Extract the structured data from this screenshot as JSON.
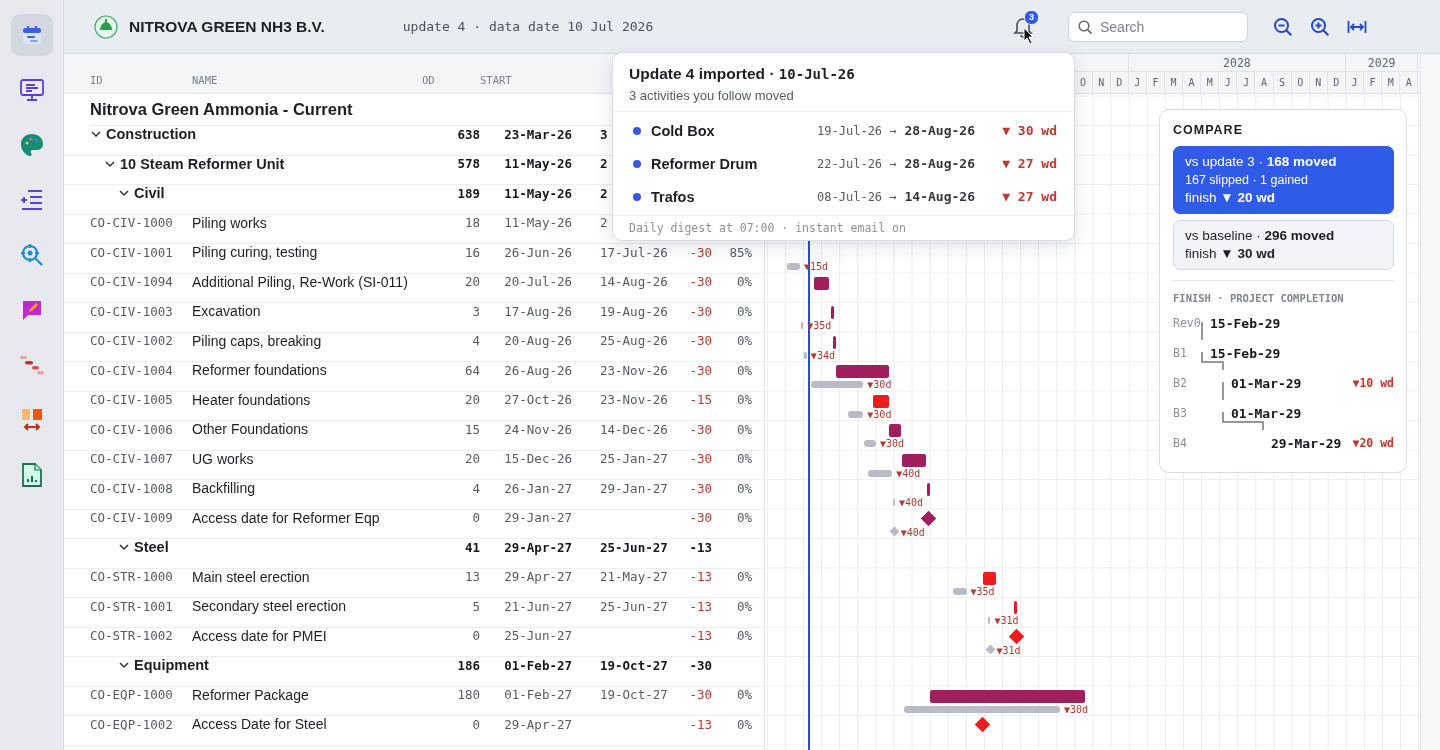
{
  "sidebar": {
    "items": [
      {
        "selected": true
      },
      {
        "selected": false
      },
      {
        "selected": false
      },
      {
        "selected": false
      },
      {
        "selected": false
      },
      {
        "selected": false
      },
      {
        "selected": false
      },
      {
        "selected": false
      },
      {
        "selected": false
      }
    ]
  },
  "header": {
    "company": "NITROVA GREEN NH3 B.V.",
    "update_info": "update 4 · data date 10 Jul 2026",
    "notification_badge": "3",
    "search": {
      "placeholder": "Search"
    }
  },
  "table": {
    "columns": [
      "ID",
      "NAME",
      "OD",
      "START"
    ],
    "project": "Nitrova Green Ammonia - Current",
    "rows": [
      {
        "kind": "group",
        "name": "Construction",
        "od": "638",
        "start": "23-Mar-26",
        "finish": "3",
        "expanded": true,
        "children": [
          {
            "kind": "group",
            "name": "10 Steam Reformer Unit",
            "od": "578",
            "start": "11-May-26",
            "finish": "2",
            "expanded": true,
            "children": [
              {
                "kind": "group",
                "name": "Civil",
                "od": "189",
                "start": "11-May-26",
                "finish": "2",
                "expanded": true,
                "children": [
                  {
                    "kind": "task",
                    "id": "CO-CIV-1000",
                    "name": "Piling works",
                    "od": "18",
                    "start": "11-May-26",
                    "finish": "2"
                  },
                  {
                    "kind": "task",
                    "id": "CO-CIV-1001",
                    "name": "Piling curing, testing",
                    "od": "16",
                    "start": "26-Jun-26",
                    "finish": "17-Jul-26",
                    "tf": "-30",
                    "pct": "85%",
                    "slip": "▼15d"
                  },
                  {
                    "kind": "task",
                    "id": "CO-CIV-1094",
                    "name": "Additional Piling, Re-Work (SI-011)",
                    "od": "20",
                    "start": "20-Jul-26",
                    "finish": "14-Aug-26",
                    "tf": "-30",
                    "pct": "0%",
                    "color": "#a21f5e"
                  },
                  {
                    "kind": "task",
                    "id": "CO-CIV-1003",
                    "name": "Excavation",
                    "od": "3",
                    "start": "17-Aug-26",
                    "finish": "19-Aug-26",
                    "tf": "-30",
                    "pct": "0%",
                    "color": "#a21f5e",
                    "slip": "▼35d"
                  },
                  {
                    "kind": "task",
                    "id": "CO-CIV-1002",
                    "name": "Piling caps, breaking",
                    "od": "4",
                    "start": "20-Aug-26",
                    "finish": "25-Aug-26",
                    "tf": "-30",
                    "pct": "0%",
                    "color": "#a21f5e",
                    "slip": "▼34d"
                  },
                  {
                    "kind": "task",
                    "id": "CO-CIV-1004",
                    "name": "Reformer foundations",
                    "od": "64",
                    "start": "26-Aug-26",
                    "finish": "23-Nov-26",
                    "tf": "-30",
                    "pct": "0%",
                    "color": "#a21f5e",
                    "slip": "▼30d"
                  },
                  {
                    "kind": "task",
                    "id": "CO-CIV-1005",
                    "name": "Heater foundations",
                    "od": "20",
                    "start": "27-Oct-26",
                    "finish": "23-Nov-26",
                    "tf": "-15",
                    "pct": "0%",
                    "color": "#ee1c1c",
                    "slip": "▼30d"
                  },
                  {
                    "kind": "task",
                    "id": "CO-CIV-1006",
                    "name": "Other Foundations",
                    "od": "15",
                    "start": "24-Nov-26",
                    "finish": "14-Dec-26",
                    "tf": "-30",
                    "pct": "0%",
                    "color": "#a21f5e",
                    "slip": "▼30d"
                  },
                  {
                    "kind": "task",
                    "id": "CO-CIV-1007",
                    "name": "UG works",
                    "od": "20",
                    "start": "15-Dec-26",
                    "finish": "25-Jan-27",
                    "tf": "-30",
                    "pct": "0%",
                    "color": "#a21f5e",
                    "slip": "▼40d"
                  },
                  {
                    "kind": "task",
                    "id": "CO-CIV-1008",
                    "name": "Backfilling",
                    "od": "4",
                    "start": "26-Jan-27",
                    "finish": "29-Jan-27",
                    "tf": "-30",
                    "pct": "0%",
                    "color": "#a21f5e",
                    "slip": "▼40d"
                  },
                  {
                    "kind": "milestone",
                    "id": "CO-CIV-1009",
                    "name": "Access date for Reformer Eqp",
                    "od": "0",
                    "start": "29-Jan-27",
                    "tf": "-30",
                    "pct": "0%",
                    "color": "#a21f5e",
                    "slip": "▼40d"
                  }
                ]
              },
              {
                "kind": "group",
                "name": "Steel",
                "od": "41",
                "start": "29-Apr-27",
                "finish": "25-Jun-27",
                "tf": "-13",
                "expanded": true,
                "children": [
                  {
                    "kind": "task",
                    "id": "CO-STR-1000",
                    "name": "Main steel erection",
                    "od": "13",
                    "start": "29-Apr-27",
                    "finish": "21-May-27",
                    "tf": "-13",
                    "pct": "0%",
                    "color": "#ee1c1c",
                    "slip": "▼35d"
                  },
                  {
                    "kind": "task",
                    "id": "CO-STR-1001",
                    "name": "Secondary steel erection",
                    "od": "5",
                    "start": "21-Jun-27",
                    "finish": "25-Jun-27",
                    "tf": "-13",
                    "pct": "0%",
                    "color": "#ee1c1c",
                    "slip": "▼31d"
                  },
                  {
                    "kind": "milestone",
                    "id": "CO-STR-1002",
                    "name": "Access date for PMEI",
                    "od": "0",
                    "start": "25-Jun-27",
                    "tf": "-13",
                    "pct": "0%",
                    "color": "#ee1c1c",
                    "slip": "▼31d"
                  }
                ]
              },
              {
                "kind": "group",
                "name": "Equipment",
                "od": "186",
                "start": "01-Feb-27",
                "finish": "19-Oct-27",
                "tf": "-30",
                "expanded": true,
                "children": [
                  {
                    "kind": "task",
                    "id": "CO-EQP-1000",
                    "name": "Reformer Package",
                    "od": "180",
                    "start": "01-Feb-27",
                    "finish": "19-Oct-27",
                    "tf": "-30",
                    "pct": "0%",
                    "color": "#a21f5e",
                    "slip": "▼30d"
                  },
                  {
                    "kind": "milestone",
                    "id": "CO-EQP-1002",
                    "name": "Access Date for Steel",
                    "od": "0",
                    "start": "29-Apr-27",
                    "tf": "-13",
                    "pct": "0%",
                    "color": "#ee1c1c"
                  }
                ]
              }
            ]
          }
        ]
      }
    ]
  },
  "timeline": {
    "earlier_months": [
      "O",
      "N",
      "D"
    ],
    "years": [
      {
        "label": "2028",
        "months": [
          "J",
          "F",
          "M",
          "A",
          "M",
          "J",
          "J",
          "A",
          "S",
          "O",
          "N",
          "D"
        ]
      },
      {
        "label": "2029",
        "months": [
          "J",
          "F",
          "M",
          "A"
        ]
      }
    ]
  },
  "notification_popup": {
    "title": "Update 4 imported · **10-Jul-26**",
    "subtitle": "3 activities you follow moved",
    "items": [
      {
        "name": "Cold Box",
        "from": "19-Jul-26 →",
        "to": "28-Aug-26",
        "delta": "▼ 30 wd"
      },
      {
        "name": "Reformer Drum",
        "from": "22-Jul-26 →",
        "to": "28-Aug-26",
        "delta": "▼ 27 wd"
      },
      {
        "name": "Trafos",
        "from": "08-Jul-26 →",
        "to": "14-Aug-26",
        "delta": "▼ 27 wd"
      }
    ],
    "footer": "Daily digest at 07:00 · instant email on"
  },
  "compare": {
    "title": "COMPARE",
    "options": [
      {
        "selected": true,
        "lines": [
          "vs update 3 · **168 moved**",
          "167 slipped · 1 gained",
          "finish **▼ 20 wd**"
        ]
      },
      {
        "selected": false,
        "lines": [
          "vs baseline · **296 moved**",
          "finish **▼ 30 wd**"
        ]
      }
    ],
    "finish_heading": "FINISH · PROJECT COMPLETION",
    "revisions": [
      {
        "entries": [
          {
            "label": "Rev0",
            "date": "15-Feb-29"
          },
          {
            "label": "B1",
            "date": "15-Feb-29"
          }
        ]
      },
      {
        "entries": [
          {
            "label": "B2",
            "date": "01-Mar-29",
            "delta": "▼10 wd"
          },
          {
            "label": "B3",
            "date": "01-Mar-29"
          }
        ]
      },
      {
        "entries": [
          {
            "label": "B4",
            "date": "29-Mar-29",
            "delta": "▼20 wd"
          }
        ]
      }
    ]
  }
}
